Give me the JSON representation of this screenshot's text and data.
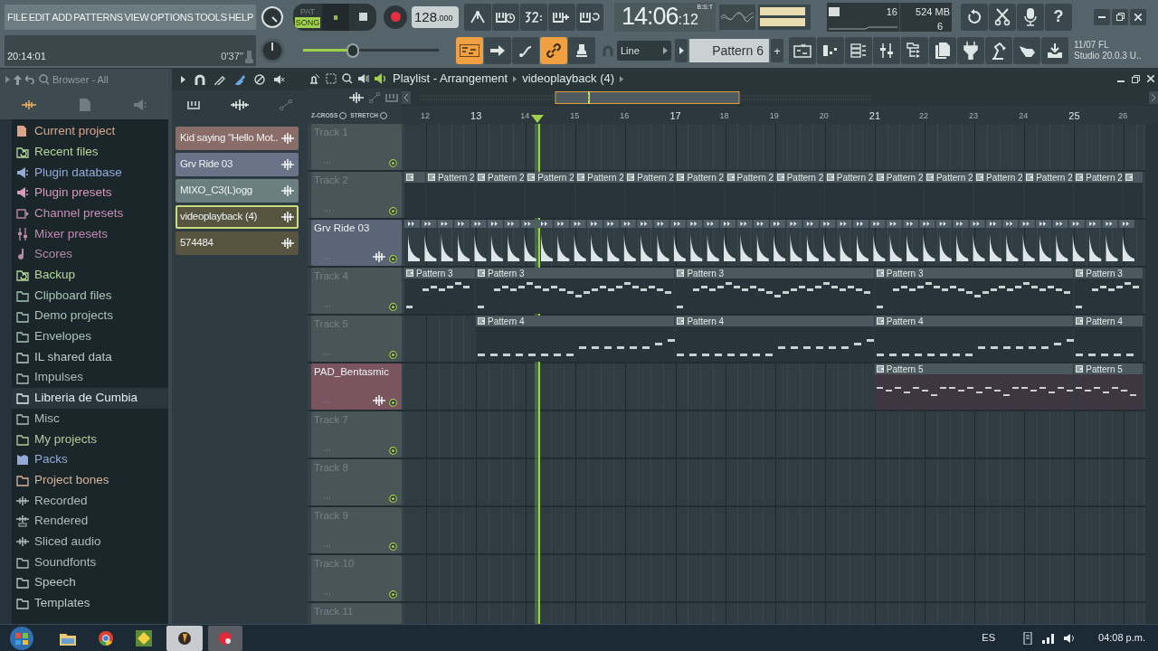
{
  "menu": [
    "FILE",
    "EDIT",
    "ADD",
    "PATTERNS",
    "VIEW",
    "OPTIONS",
    "TOOLS",
    "HELP"
  ],
  "hint": {
    "time": "20:14:01",
    "duration": "0'37''"
  },
  "transport": {
    "pat_label": "PAT",
    "song_label": "SONG",
    "song_mode": true,
    "pause_symbol": "⏸",
    "tempo": "128",
    "tempo_fraction": ".000",
    "time_main": "14:06",
    "time_sub": ":12",
    "time_label": "B:S:T"
  },
  "master_pitch": {
    "level": 0.35
  },
  "performance": {
    "cpu": "16",
    "memory": "524 MB",
    "polyphony": "6",
    "help": "?"
  },
  "snap": "Line",
  "pattern": "Pattern 6",
  "pattern_add": "+",
  "news": {
    "line1": "11/07  FL",
    "line2": "Studio 20.0.3 U.."
  },
  "browser": {
    "title": "Browser - All",
    "items": [
      {
        "label": "Current project",
        "kind": "project",
        "color": "#d9a58c",
        "selected": false
      },
      {
        "label": "Recent files",
        "kind": "recent",
        "color": "#b4d79a",
        "selected": false
      },
      {
        "label": "Plugin database",
        "kind": "plugin",
        "color": "#93aad6",
        "selected": false
      },
      {
        "label": "Plugin presets",
        "kind": "plugin",
        "color": "#d79abc",
        "selected": false
      },
      {
        "label": "Channel presets",
        "kind": "channel",
        "color": "#c98fb4",
        "selected": false
      },
      {
        "label": "Mixer presets",
        "kind": "mixer",
        "color": "#c08aae",
        "selected": false
      },
      {
        "label": "Scores",
        "kind": "note",
        "color": "#b48aa8",
        "selected": false
      },
      {
        "label": "Backup",
        "kind": "recent",
        "color": "#b4d79a",
        "selected": false
      },
      {
        "label": "Clipboard files",
        "kind": "folder",
        "color": "#a8c4b4",
        "selected": false
      },
      {
        "label": "Demo projects",
        "kind": "folder",
        "color": "#a8c4b4",
        "selected": false
      },
      {
        "label": "Envelopes",
        "kind": "folder",
        "color": "#a8c4b4",
        "selected": false
      },
      {
        "label": "IL shared data",
        "kind": "folder",
        "color": "#b8ccc4",
        "selected": false
      },
      {
        "label": "Impulses",
        "kind": "folder",
        "color": "#aebcbe",
        "selected": false
      },
      {
        "label": "Libreria de Cumbia",
        "kind": "folder",
        "color": "#e4ecee",
        "selected": true
      },
      {
        "label": "Misc",
        "kind": "folder",
        "color": "#aebcbe",
        "selected": false
      },
      {
        "label": "My projects",
        "kind": "folder",
        "color": "#b0cc98",
        "selected": false
      },
      {
        "label": "Packs",
        "kind": "packs",
        "color": "#93aad6",
        "selected": false
      },
      {
        "label": "Project bones",
        "kind": "folder",
        "color": "#d4b49c",
        "selected": false
      },
      {
        "label": "Recorded",
        "kind": "wave",
        "color": "#aebcbe",
        "selected": false
      },
      {
        "label": "Rendered",
        "kind": "rendered",
        "color": "#aebcbe",
        "selected": false
      },
      {
        "label": "Sliced audio",
        "kind": "wave",
        "color": "#aebcbe",
        "selected": false
      },
      {
        "label": "Soundfonts",
        "kind": "folder",
        "color": "#aebcbe",
        "selected": false
      },
      {
        "label": "Speech",
        "kind": "folder",
        "color": "#b8ccc4",
        "selected": false
      },
      {
        "label": "Templates",
        "kind": "folder",
        "color": "#b8ccc4",
        "selected": false
      }
    ]
  },
  "channels": [
    {
      "name": "Kid saying \"Hello Mot..",
      "color": "#8a6c68",
      "selected": false
    },
    {
      "name": "Grv Ride 03",
      "color": "#6a7388",
      "selected": false
    },
    {
      "name": "MIXO_C3(L)ogg",
      "color": "#6b7f80",
      "selected": false
    },
    {
      "name": "videoplayback (4)",
      "color": "#57553f",
      "selected": true
    },
    {
      "name": "574484",
      "color": "#57553f",
      "selected": false
    }
  ],
  "playlist": {
    "title": "Playlist - Arrangement",
    "crumb": "videoplayback (4)",
    "zcross": "Z-CROSS",
    "stretch": "STRETCH",
    "playhead": {
      "level": 0.184
    },
    "ruler": [
      {
        "label": "12",
        "kind": "minor"
      },
      {
        "label": "13",
        "kind": "major"
      },
      {
        "label": "14",
        "kind": "minor"
      },
      {
        "label": "15",
        "kind": "minor"
      },
      {
        "label": "16",
        "kind": "minor"
      },
      {
        "label": "17",
        "kind": "major"
      },
      {
        "label": "18",
        "kind": "minor"
      },
      {
        "label": "19",
        "kind": "minor"
      },
      {
        "label": "20",
        "kind": "minor"
      },
      {
        "label": "21",
        "kind": "major"
      },
      {
        "label": "22",
        "kind": "minor"
      },
      {
        "label": "23",
        "kind": "minor"
      },
      {
        "label": "24",
        "kind": "minor"
      },
      {
        "label": "25",
        "kind": "major"
      },
      {
        "label": "26",
        "kind": "minor"
      }
    ],
    "tracks": [
      {
        "name": "Track 1",
        "kind": "default",
        "color": "#4a5558"
      },
      {
        "name": "Track 2",
        "kind": "default",
        "color": "#4a5558",
        "clips": [
          {
            "kind": "blank"
          },
          {
            "kind": "blank",
            "label": "Pattern 2"
          },
          {
            "kind": "blank",
            "label": "Pattern 2"
          },
          {
            "kind": "blank",
            "label": "Pattern 2"
          },
          {
            "kind": "blank",
            "label": "Pattern 2"
          },
          {
            "kind": "blank",
            "label": "Pattern 2"
          },
          {
            "kind": "blank",
            "label": "Pattern 2"
          },
          {
            "kind": "blank",
            "label": "Pattern 2"
          },
          {
            "kind": "blank",
            "label": "Pattern 2"
          },
          {
            "kind": "blank",
            "label": "Pattern 2"
          },
          {
            "kind": "blank",
            "label": "Pattern 2"
          },
          {
            "kind": "blank",
            "label": "Pattern 2"
          },
          {
            "kind": "blank",
            "label": "Pattern 2"
          },
          {
            "kind": "blank",
            "label": "Pattern 2"
          },
          {
            "kind": "blank",
            "label": "Pattern 2"
          },
          {
            "kind": "blank"
          }
        ]
      },
      {
        "name": "Grv Ride 03",
        "kind": "audio",
        "color": "#5c6478",
        "clips": [
          {
            "kind": "audio"
          }
        ]
      },
      {
        "name": "Track 4",
        "kind": "default",
        "color": "#4a5558",
        "clips": [
          {
            "kind": "melody",
            "label": "Pattern 3"
          },
          {
            "kind": "melody",
            "label": "Pattern 3"
          },
          {
            "kind": "melody",
            "label": "Pattern 3"
          },
          {
            "kind": "melody",
            "label": "Pattern 3"
          },
          {
            "kind": "melody",
            "label": "Pattern 3"
          }
        ]
      },
      {
        "name": "Track 5",
        "kind": "default",
        "color": "#4a5558",
        "clips": [
          {
            "kind": "steps",
            "label": "Pattern 4"
          },
          {
            "kind": "steps",
            "label": "Pattern 4"
          },
          {
            "kind": "steps",
            "label": "Pattern 4"
          },
          {
            "kind": "steps",
            "label": "Pattern 4"
          }
        ]
      },
      {
        "name": "PAD_Bentasmic",
        "kind": "audio",
        "color": "#7a5560",
        "clips": [
          {
            "kind": "chords",
            "label": "Pattern 5"
          },
          {
            "kind": "chords",
            "label": "Pattern 5"
          }
        ]
      },
      {
        "name": "Track 7",
        "kind": "default",
        "color": "#4a5558"
      },
      {
        "name": "Track 8",
        "kind": "default",
        "color": "#4a5558"
      },
      {
        "name": "Track 9",
        "kind": "default",
        "color": "#4a5558"
      },
      {
        "name": "Track 10",
        "kind": "default",
        "color": "#4a5558"
      },
      {
        "name": "Track 11",
        "kind": "default",
        "color": "#4a5558"
      }
    ]
  },
  "taskbar": {
    "language": "ES",
    "clock": "04:08 p.m."
  }
}
